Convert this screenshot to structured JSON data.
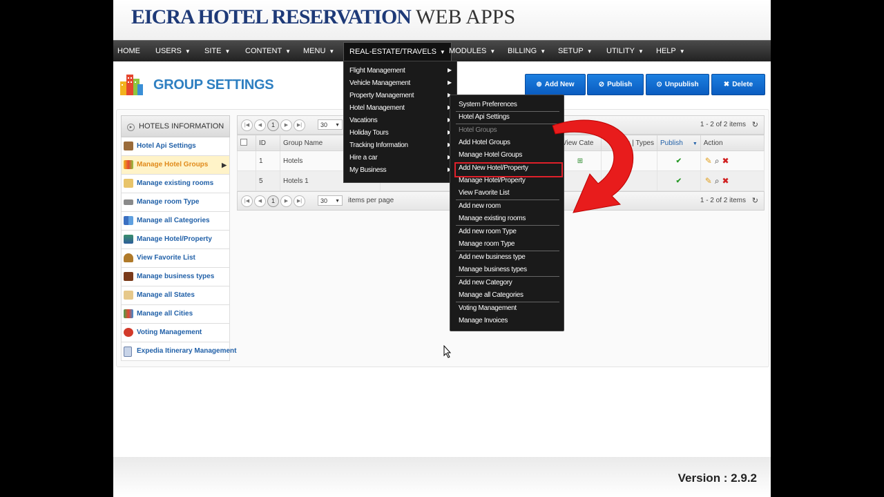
{
  "brand": {
    "title_bold": "EICRA HOTEL RESERVATION",
    "title_light": "WEB APPS"
  },
  "nav": {
    "items": [
      {
        "label": "HOME",
        "caret": false
      },
      {
        "label": "USERS",
        "caret": true
      },
      {
        "label": "SITE",
        "caret": true
      },
      {
        "label": "CONTENT",
        "caret": true
      },
      {
        "label": "MENU",
        "caret": true
      },
      {
        "label": "REAL-ESTATE/TRAVELS",
        "caret": true,
        "active": true
      },
      {
        "label": "MODULES",
        "caret": true
      },
      {
        "label": "BILLING",
        "caret": true
      },
      {
        "label": "SETUP",
        "caret": true
      },
      {
        "label": "UTILITY",
        "caret": true
      },
      {
        "label": "HELP",
        "caret": true
      }
    ],
    "caret_glyph": "▼"
  },
  "page": {
    "title": "GROUP SETTINGS"
  },
  "toolbar": {
    "add_new": "Add New",
    "publish": "Publish",
    "unpublish": "Unpublish",
    "delete": "Delete"
  },
  "sidebar": {
    "header": "HOTELS INFORMATION",
    "items": [
      {
        "label": "Hotel Api Settings",
        "icon": "tools-icon"
      },
      {
        "label": "Manage Hotel Groups",
        "icon": "buildings-icon",
        "active": true
      },
      {
        "label": "Manage existing rooms",
        "icon": "building-icon"
      },
      {
        "label": "Manage room Type",
        "icon": "bed-icon"
      },
      {
        "label": "Manage all Categories",
        "icon": "books-icon"
      },
      {
        "label": "Manage Hotel/Property",
        "icon": "hotel-icon"
      },
      {
        "label": "View Favorite List",
        "icon": "bell-icon"
      },
      {
        "label": "Manage business types",
        "icon": "book-icon"
      },
      {
        "label": "Manage all States",
        "icon": "map-icon"
      },
      {
        "label": "Manage all Cities",
        "icon": "city-icon"
      },
      {
        "label": "Voting Management",
        "icon": "vote-icon"
      },
      {
        "label": "Expedia Itinerary Management",
        "icon": "document-icon"
      }
    ]
  },
  "grid": {
    "pager_top": {
      "page": "1",
      "page_size": "30",
      "info": "1 - 2 of 2 items"
    },
    "pager_bottom": {
      "page": "1",
      "page_size": "30",
      "per_page_label": "items per page",
      "info": "1 - 2 of 2 items"
    },
    "columns": {
      "id": "ID",
      "group_name": "Group Name",
      "view_cat": "View Cate",
      "types": "s | Types",
      "publish": "Publish",
      "action": "Action"
    },
    "rows": [
      {
        "id": "1",
        "name": "Hotels"
      },
      {
        "id": "5",
        "name": "Hotels 1"
      }
    ]
  },
  "menu_realestate": {
    "items": [
      "Flight Management",
      "Vehicle Management",
      "Property Management",
      "Hotel Management",
      "Vacations",
      "Holiday Tours",
      "Tracking Information",
      "Hire a car",
      "My Business"
    ]
  },
  "menu_hotel": {
    "items": [
      {
        "label": "System Preferences"
      },
      {
        "label": "Hotel Api Settings"
      },
      {
        "label": "Hotel Groups",
        "dim": true
      },
      {
        "label": "Add Hotel Groups"
      },
      {
        "label": "Manage Hotel Groups"
      },
      {
        "label": "Add New Hotel/Property",
        "highlight": true
      },
      {
        "label": "Manage Hotel/Property"
      },
      {
        "label": "View Favorite List"
      },
      {
        "label": "Add new room"
      },
      {
        "label": "Manage existing rooms"
      },
      {
        "label": "Add new room Type"
      },
      {
        "label": "Manage room Type"
      },
      {
        "label": "Add new business type"
      },
      {
        "label": "Manage business types"
      },
      {
        "label": "Add new Category"
      },
      {
        "label": "Manage all Categories"
      },
      {
        "label": "Voting Management"
      },
      {
        "label": "Manage Invoices"
      }
    ]
  },
  "footer": {
    "version": "Version : 2.9.2"
  },
  "colors": {
    "accent": "#2e7fc1",
    "button": "#0a5cc0",
    "highlight": "#e0202a",
    "active_side": "#e08a1a"
  }
}
